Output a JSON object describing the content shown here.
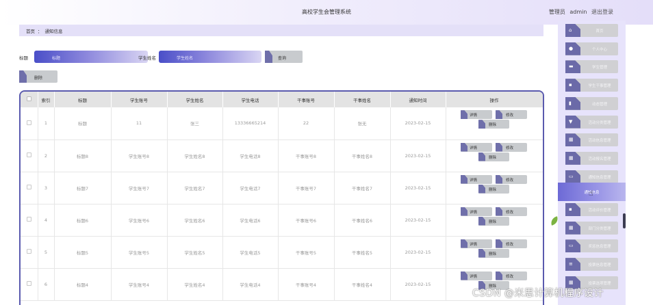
{
  "header": {
    "title": "高校学生会管理系统",
    "role": "管理员",
    "username": "admin",
    "logout": "退出登录"
  },
  "breadcrumb": {
    "home": "首页",
    "separator": "：",
    "current": "通知信息"
  },
  "search": {
    "title_label": "标题",
    "title_placeholder": "标题",
    "name_label": "学生姓名",
    "name_placeholder": "学生姓名",
    "query_button": "查询",
    "delete_button": "删除"
  },
  "table": {
    "columns": [
      "",
      "索引",
      "标题",
      "学生账号",
      "学生姓名",
      "学生电话",
      "干事账号",
      "干事姓名",
      "通知时间",
      "操作"
    ],
    "rows": [
      {
        "index": "1",
        "title": "标题",
        "account": "11",
        "name": "张三",
        "phone": "13336665214",
        "staff_account": "22",
        "staff_name": "张无",
        "time": "2023-02-15"
      },
      {
        "index": "2",
        "title": "标题8",
        "account": "学生账号8",
        "name": "学生姓名8",
        "phone": "学生电话8",
        "staff_account": "干事账号8",
        "staff_name": "干事姓名8",
        "time": "2023-02-15"
      },
      {
        "index": "3",
        "title": "标题7",
        "account": "学生账号7",
        "name": "学生姓名7",
        "phone": "学生电话7",
        "staff_account": "干事账号7",
        "staff_name": "干事姓名7",
        "time": "2023-02-15"
      },
      {
        "index": "4",
        "title": "标题6",
        "account": "学生账号6",
        "name": "学生姓名6",
        "phone": "学生电话6",
        "staff_account": "干事账号6",
        "staff_name": "干事姓名6",
        "time": "2023-02-15"
      },
      {
        "index": "5",
        "title": "标题5",
        "account": "学生账号5",
        "name": "学生姓名5",
        "phone": "学生电话5",
        "staff_account": "干事账号5",
        "staff_name": "干事姓名5",
        "time": "2023-02-15"
      },
      {
        "index": "6",
        "title": "标题4",
        "account": "学生账号4",
        "name": "学生姓名4",
        "phone": "学生电话4",
        "staff_account": "干事账号4",
        "staff_name": "干事姓名4",
        "time": "2023-02-15"
      }
    ],
    "actions": {
      "detail": "详情",
      "edit": "修改",
      "delete": "删除"
    }
  },
  "sidebar": {
    "items": [
      {
        "label": "首页",
        "icon": "home-icon",
        "glyph": "⌂"
      },
      {
        "label": "个人中心",
        "icon": "user-icon",
        "glyph": "●"
      },
      {
        "label": "学生管理",
        "icon": "folder-icon",
        "glyph": "▬"
      },
      {
        "label": "学生干事管理",
        "icon": "document-icon",
        "glyph": "▪"
      },
      {
        "label": "动态管理",
        "icon": "bar-chart-icon",
        "glyph": "▮"
      },
      {
        "label": "活动分类管理",
        "icon": "shield-icon",
        "glyph": "▼"
      },
      {
        "label": "活动信息管理",
        "icon": "grid-icon",
        "glyph": "▦"
      },
      {
        "label": "活动报名管理",
        "icon": "grid-icon",
        "glyph": "▦"
      },
      {
        "label": "通知信息管理",
        "icon": "book-icon",
        "glyph": "▭"
      },
      {
        "label": "通知信息",
        "icon": "",
        "glyph": ""
      },
      {
        "label": "活动评价管理",
        "icon": "document-icon",
        "glyph": "▪"
      },
      {
        "label": "部门分类管理",
        "icon": "grid-icon",
        "glyph": "▦"
      },
      {
        "label": "奖惩信息管理",
        "icon": "book-icon",
        "glyph": "▭"
      },
      {
        "label": "投票信息管理",
        "icon": "list-icon",
        "glyph": "≡"
      },
      {
        "label": "投票选项管理",
        "icon": "grid-icon",
        "glyph": "▦"
      }
    ],
    "active_index": 9
  },
  "watermark": "CSDN @米思计算机程序设计"
}
